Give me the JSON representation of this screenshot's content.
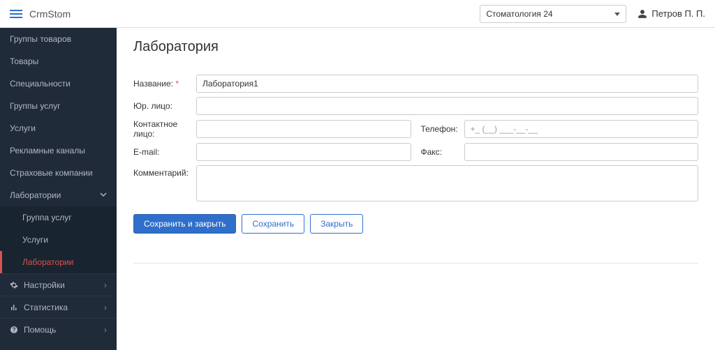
{
  "header": {
    "brand": "CrmStom",
    "org_selected": "Стоматология 24",
    "user_name": "Петров П. П."
  },
  "sidebar": {
    "items": [
      {
        "label": "Группы товаров"
      },
      {
        "label": "Товары"
      },
      {
        "label": "Специальности"
      },
      {
        "label": "Группы услуг"
      },
      {
        "label": "Услуги"
      },
      {
        "label": "Рекламные каналы"
      },
      {
        "label": "Страховые компании"
      },
      {
        "label": "Лаборатории"
      }
    ],
    "sub_items": [
      {
        "label": "Группа услуг"
      },
      {
        "label": "Услуги"
      },
      {
        "label": "Лаборатории"
      }
    ],
    "footer": [
      {
        "label": "Настройки"
      },
      {
        "label": "Статистика"
      },
      {
        "label": "Помощь"
      }
    ]
  },
  "page": {
    "title": "Лаборатория",
    "labels": {
      "name": "Название:",
      "legal": "Юр. лицо:",
      "contact": "Контактное лицо:",
      "phone": "Телефон:",
      "email": "E-mail:",
      "fax": "Факс:",
      "comment": "Комментарий:"
    },
    "values": {
      "name": "Лаборатория1",
      "legal": "",
      "contact": "",
      "phone_placeholder": "+_ (__) ___-__-__",
      "email": "",
      "fax": "",
      "comment": ""
    },
    "buttons": {
      "save_close": "Сохранить и закрыть",
      "save": "Сохранить",
      "close": "Закрыть"
    }
  }
}
